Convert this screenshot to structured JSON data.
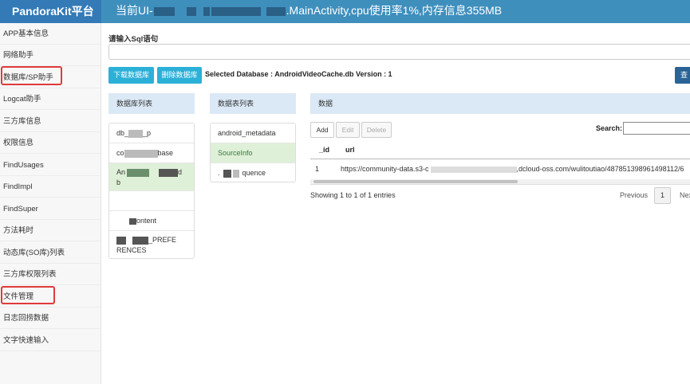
{
  "header": {
    "brand": "PandoraKit平台",
    "status_prefix": "当前UI-",
    "status_suffix": ".MainActivity,cpu使用率1%,内存信息355MB"
  },
  "sidebar": {
    "items": [
      {
        "label": "APP基本信息"
      },
      {
        "label": "网络助手"
      },
      {
        "label": "数据库/SP助手"
      },
      {
        "label": "Logcat助手"
      },
      {
        "label": "三方库信息"
      },
      {
        "label": "权限信息"
      },
      {
        "label": "FindUsages"
      },
      {
        "label": "FindImpl"
      },
      {
        "label": "FindSuper"
      },
      {
        "label": "方法耗时"
      },
      {
        "label": "动态库(SO库)列表"
      },
      {
        "label": "三方库权限列表"
      },
      {
        "label": "文件管理"
      },
      {
        "label": "日志回捞数据"
      },
      {
        "label": "文字快速输入"
      }
    ]
  },
  "sql": {
    "label": "请输入Sql语句",
    "value": ""
  },
  "toolbar": {
    "download_label": "下载数据库",
    "delete_label": "删除数据库",
    "db_info": "Selected Database : AndroidVideoCache.db Version : 1",
    "query_label": "查"
  },
  "databases": {
    "header": "数据库列表",
    "items": [
      {
        "label_start": "db_",
        "label_end": "_p"
      },
      {
        "label_start": "co",
        "label_end": "base"
      },
      {
        "label_start": "An",
        "label_end": "d",
        "label_line2": "b"
      },
      {
        "label_start": "",
        "label_end": ""
      },
      {
        "label_start": "",
        "label_end": "ontent"
      },
      {
        "label_start": "",
        "label_end": "_PREFE",
        "label_line2": "RENCES"
      }
    ]
  },
  "tables": {
    "header": "数据表列表",
    "items": [
      {
        "label": "android_metadata"
      },
      {
        "label": "SourceInfo"
      },
      {
        "label_start": ".",
        "label_end": "quence"
      }
    ]
  },
  "data_panel": {
    "header": "数据",
    "add_label": "Add",
    "edit_label": "Edit",
    "delete_label": "Delete",
    "search_label": "Search:",
    "search_value": "",
    "columns": [
      "_id",
      "url"
    ],
    "rows": [
      {
        "id": "1",
        "url_start": "https://community-data.s3-c",
        "url_end": ",dcloud-oss.com/wulitoutiao/487851398961498112/6"
      }
    ],
    "entries_text": "Showing 1 to 1 of 1 entries",
    "previous_label": "Previous",
    "page": "1",
    "next_label": "Next"
  }
}
